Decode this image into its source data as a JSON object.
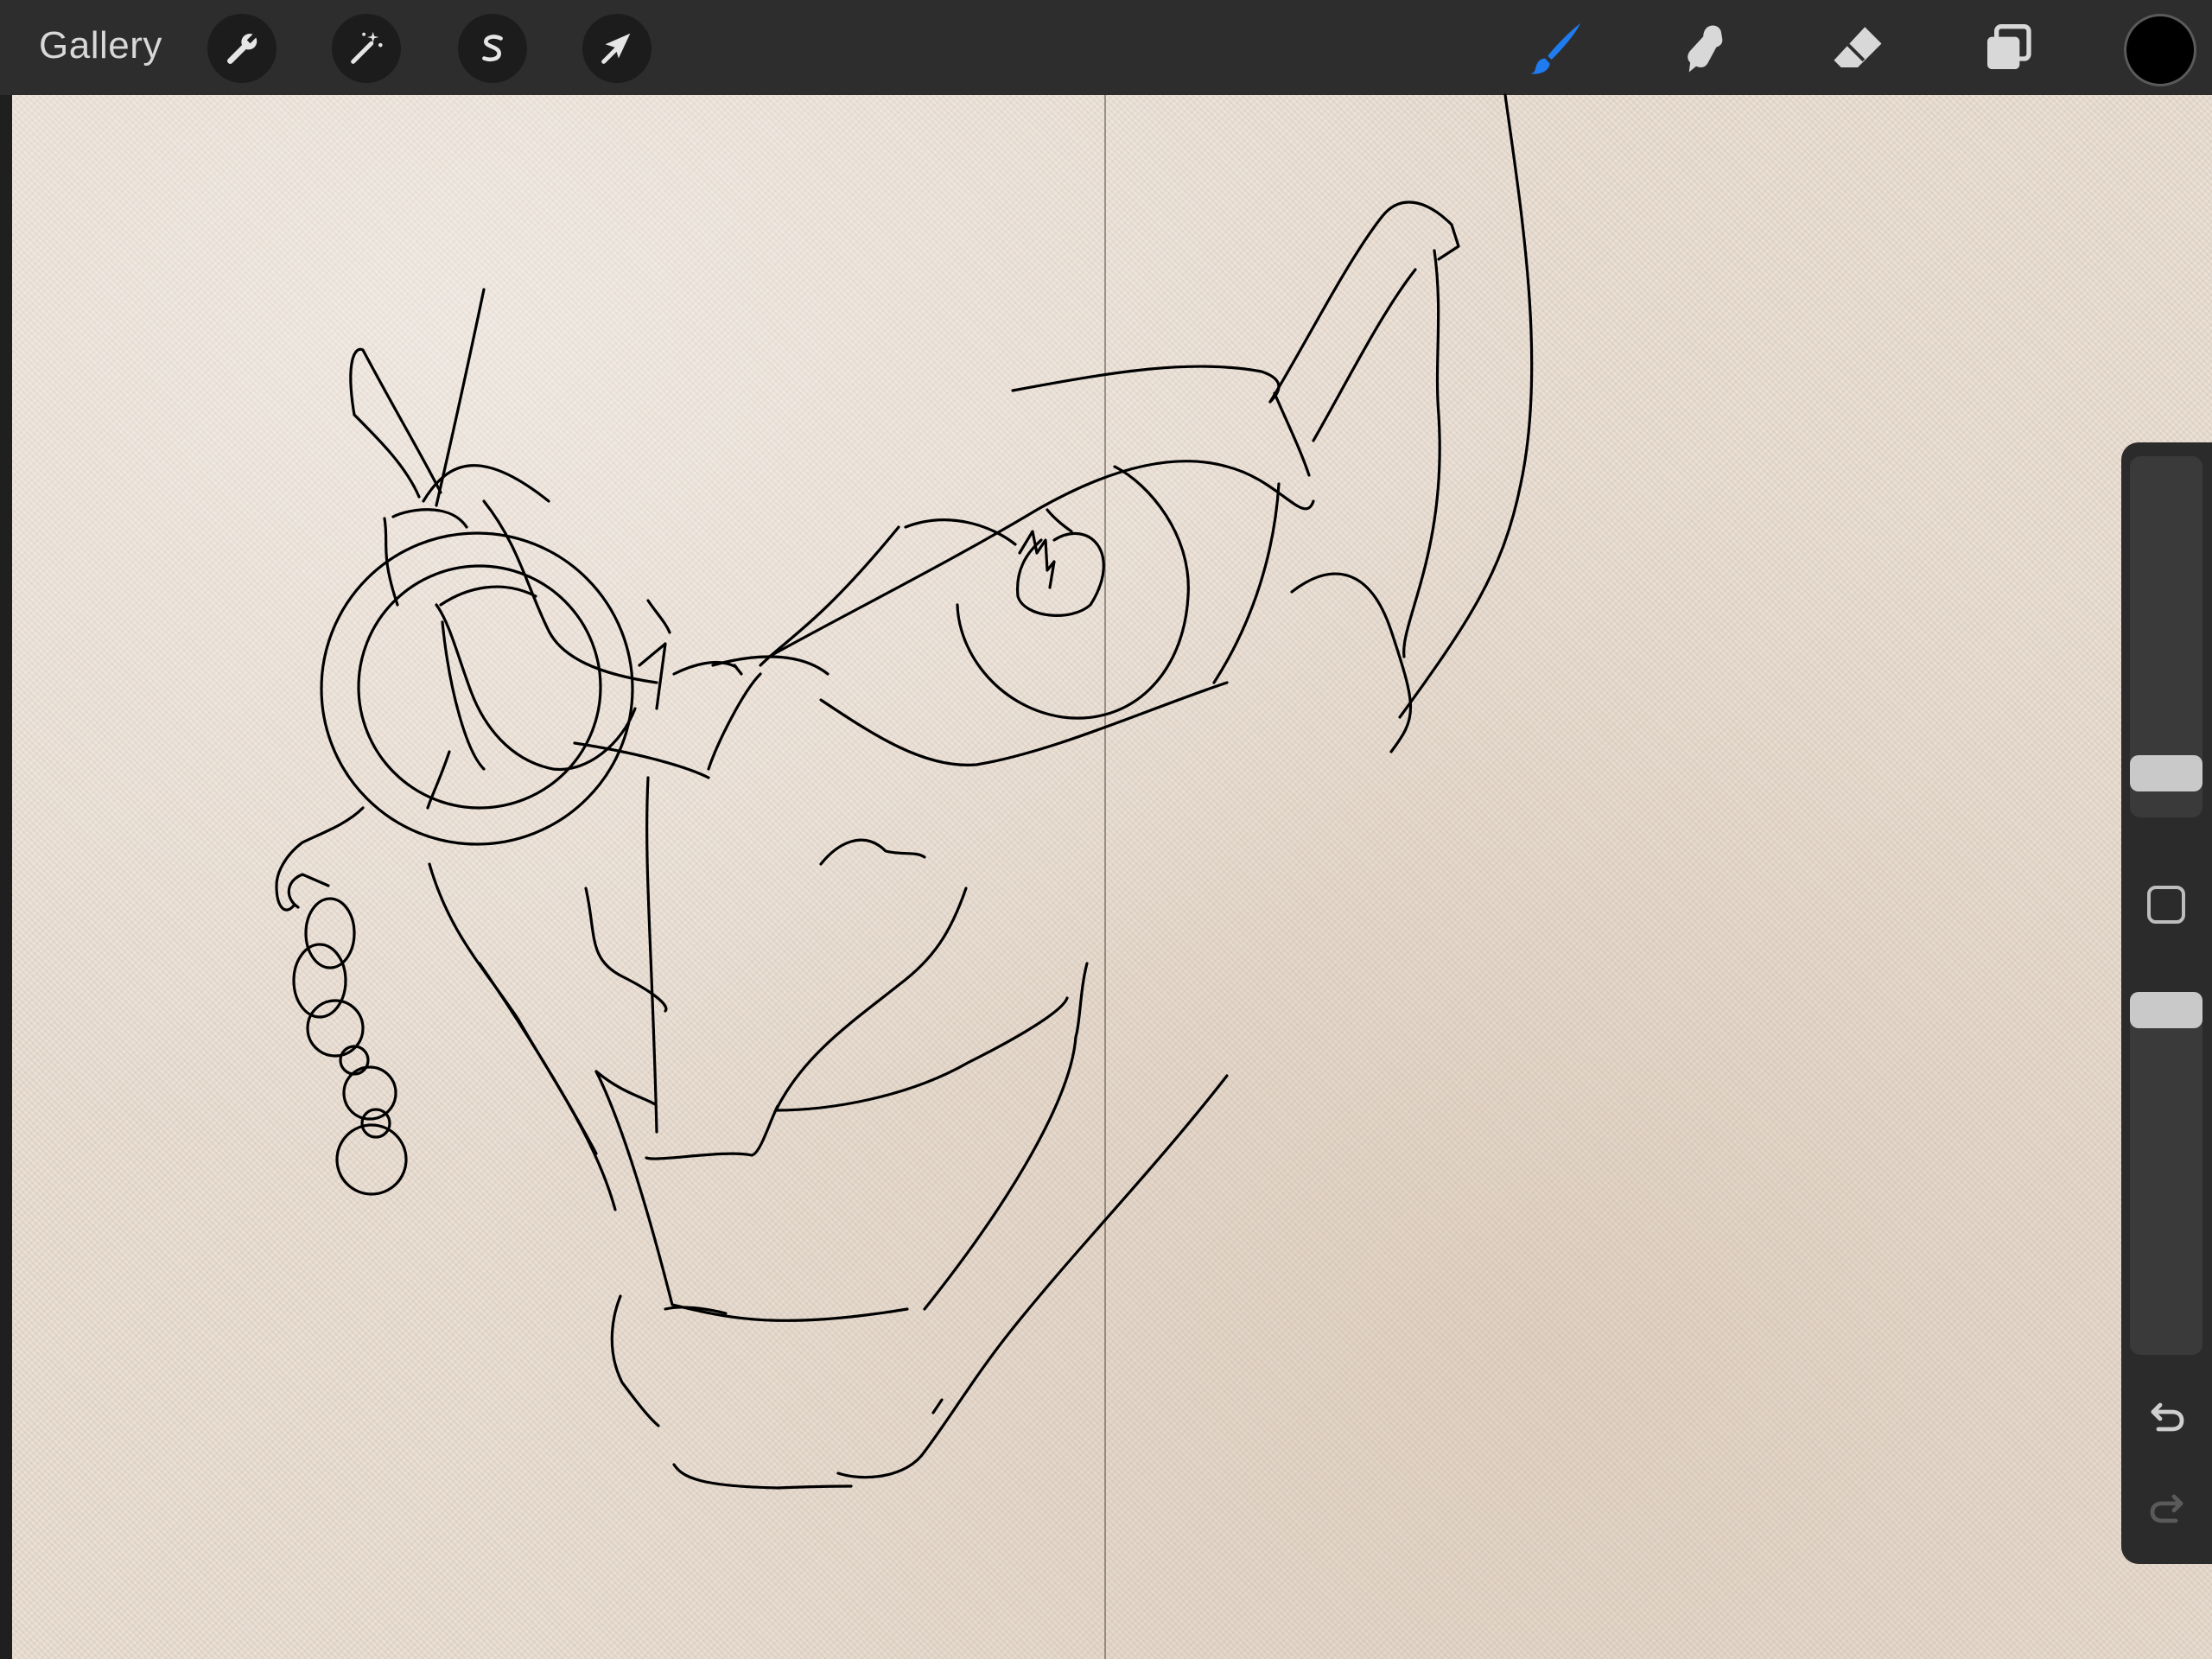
{
  "topbar": {
    "gallery_label": "Gallery",
    "left_tools": [
      "wrench-icon",
      "magic-wand-icon",
      "selection-s-icon",
      "transform-arrow-icon"
    ],
    "right_tools": [
      "brush-icon",
      "smudge-icon",
      "eraser-icon",
      "layers-icon"
    ],
    "active_tool": "brush-icon",
    "active_tool_color": "#1e7bf0",
    "current_color": "#000000"
  },
  "canvas": {
    "paper_color": "#e8ddd2",
    "stroke_color": "#000000"
  },
  "sidebar": {
    "brush_size_level": 0.08,
    "opacity_level": 1.0,
    "undo_icon": "undo-icon",
    "redo_icon": "redo-icon",
    "redo_enabled": false
  }
}
